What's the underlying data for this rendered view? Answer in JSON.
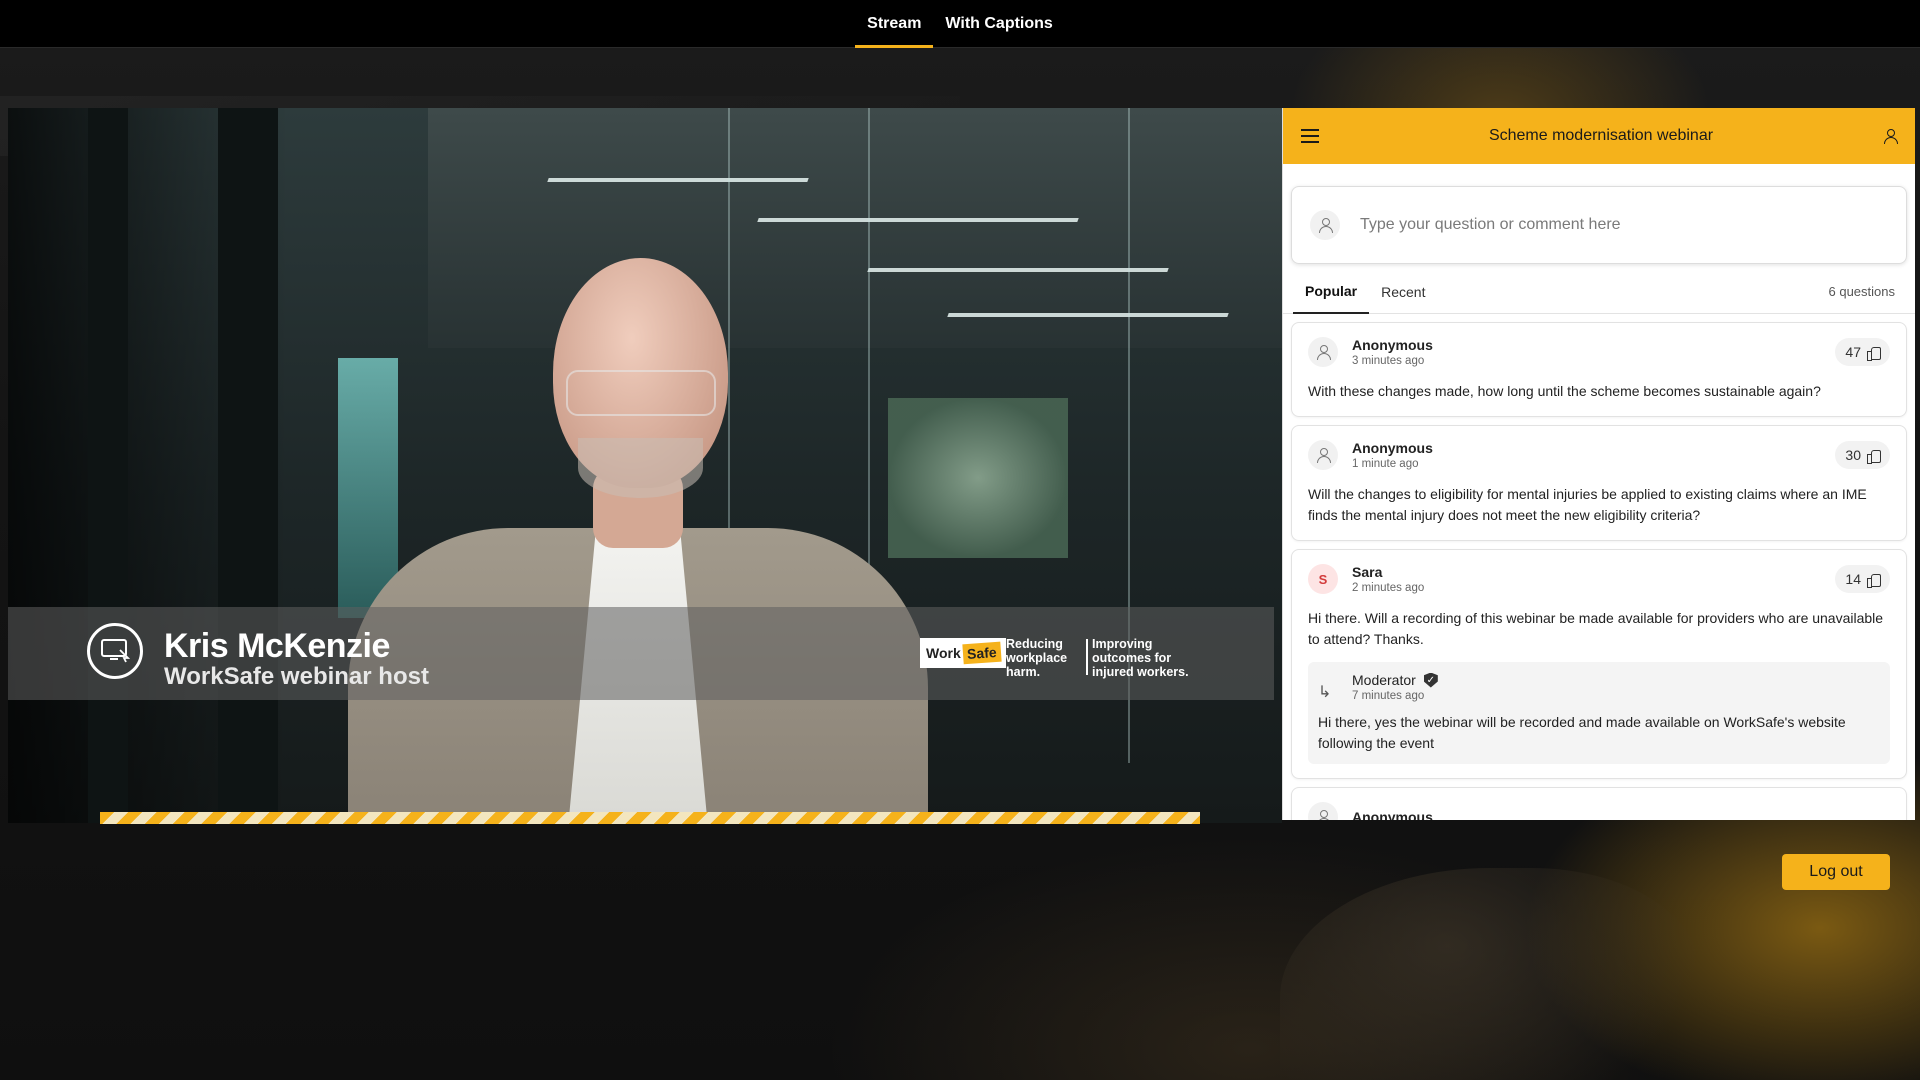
{
  "nav": {
    "tabs": [
      {
        "label": "Stream",
        "active": true
      },
      {
        "label": "With Captions",
        "active": false
      }
    ]
  },
  "video": {
    "presenter_name": "Kris McKenzie",
    "presenter_role": "WorkSafe webinar host",
    "brand_logo": {
      "work": "Work",
      "safe": "Safe"
    },
    "tagline_1": "Reducing workplace harm.",
    "tagline_2": "Improving outcomes for injured workers."
  },
  "qa": {
    "title": "Scheme modernisation webinar",
    "input_placeholder": "Type your question or comment here",
    "tabs": [
      {
        "label": "Popular",
        "active": true
      },
      {
        "label": "Recent",
        "active": false
      }
    ],
    "count_label": "6 questions",
    "questions": [
      {
        "author": "Anonymous",
        "time": "3 minutes ago",
        "votes": "47",
        "text": "With these changes made, how long until the scheme becomes sustainable again?"
      },
      {
        "author": "Anonymous",
        "time": "1 minute ago",
        "votes": "30",
        "text": "Will the changes to eligibility for mental injuries be applied to existing claims where an IME finds the mental injury does not meet the new eligibility criteria?"
      },
      {
        "author": "Sara",
        "avatar_initial": "S",
        "time": "2 minutes ago",
        "votes": "14",
        "text": "Hi there. Will a recording of this webinar be made available for providers who are unavailable to attend? Thanks.",
        "reply": {
          "author": "Moderator",
          "time": "7 minutes ago",
          "text": "Hi there, yes the webinar will be recorded and made available on WorkSafe's website following the event"
        }
      },
      {
        "author": "Anonymous"
      }
    ]
  },
  "logout_label": "Log out",
  "colors": {
    "accent": "#f5b21b",
    "background": "#0d0d0d"
  },
  "icons": {
    "menu": "hamburger-icon",
    "user": "user-icon",
    "thumb": "thumbs-up-icon",
    "reply": "reply-arrow-icon",
    "verified": "verified-badge-icon"
  }
}
